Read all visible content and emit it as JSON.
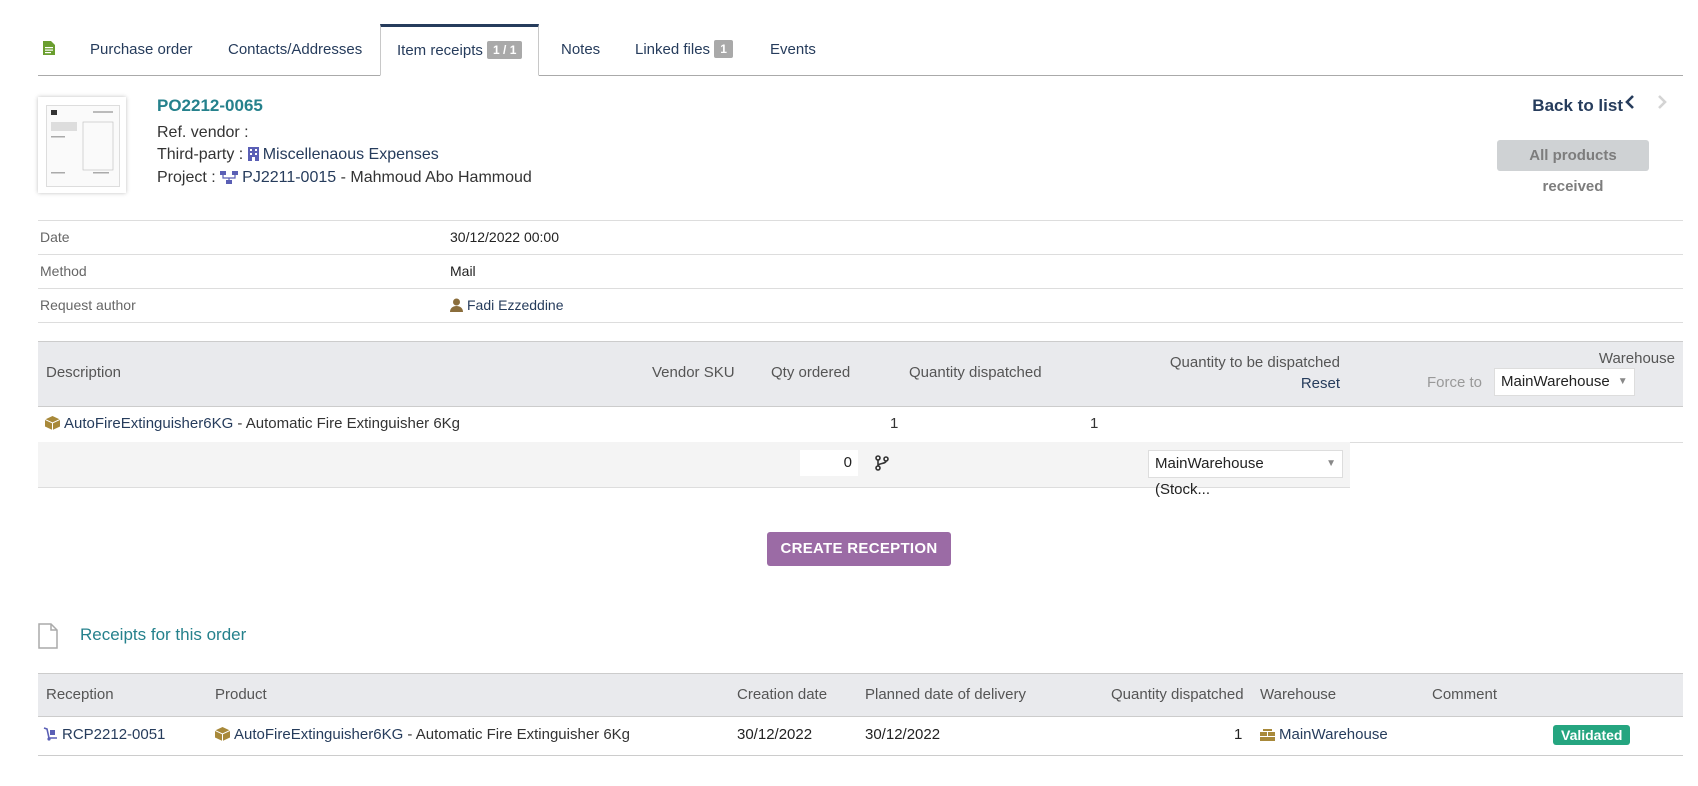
{
  "tabs": [
    {
      "label": "Purchase order"
    },
    {
      "label": "Contacts/Addresses"
    },
    {
      "label": "Item receipts",
      "badge": "1 / 1"
    },
    {
      "label": "Notes"
    },
    {
      "label": "Linked files",
      "badge": "1"
    },
    {
      "label": "Events"
    }
  ],
  "header": {
    "ref": "PO2212-0065",
    "ref_vendor_label": "Ref. vendor :",
    "third_party_label": "Third-party :",
    "third_party": "Miscellenaous Expenses",
    "project_label": "Project :",
    "project_ref": "PJ2211-0015",
    "project_name": "- Mahmoud Abo Hammoud",
    "back_to_list": "Back to list",
    "status_button": "All products received"
  },
  "info": [
    {
      "label": "Date",
      "value": "30/12/2022 00:00"
    },
    {
      "label": "Method",
      "value": "Mail"
    },
    {
      "label": "Request author",
      "value": "Fadi Ezzeddine"
    }
  ],
  "lines": {
    "headers": {
      "description": "Description",
      "vendor_sku": "Vendor SKU",
      "qty_ordered": "Qty ordered",
      "qty_dispatched": "Quantity dispatched",
      "qty_to_dispatch": "Quantity to be dispatched",
      "reset": "Reset",
      "warehouse": "Warehouse",
      "force_to": "Force to",
      "force_to_value": "MainWarehouse"
    },
    "row": {
      "product_ref": "AutoFireExtinguisher6KG",
      "product_label": "- Automatic Fire Extinguisher 6Kg",
      "qty_ordered": "1",
      "qty_dispatched": "1",
      "qty_input": "0",
      "warehouse_select": "MainWarehouse (Stock..."
    }
  },
  "create_button": "CREATE RECEPTION",
  "receipts": {
    "title": "Receipts for this order",
    "headers": {
      "reception": "Reception",
      "product": "Product",
      "creation_date": "Creation date",
      "planned_date": "Planned date of delivery",
      "qty_dispatched": "Quantity dispatched",
      "warehouse": "Warehouse",
      "comment": "Comment"
    },
    "row": {
      "reception": "RCP2212-0051",
      "product_ref": "AutoFireExtinguisher6KG",
      "product_label": "- Automatic Fire Extinguisher 6Kg",
      "creation_date": "30/12/2022",
      "planned_date": "30/12/2022",
      "qty": "1",
      "warehouse": "MainWarehouse",
      "status": "Validated"
    }
  },
  "colors": {
    "link": "#263c5c",
    "accent_teal": "#25818c",
    "create_button": "#9b6ba5",
    "validated": "#25a580"
  }
}
